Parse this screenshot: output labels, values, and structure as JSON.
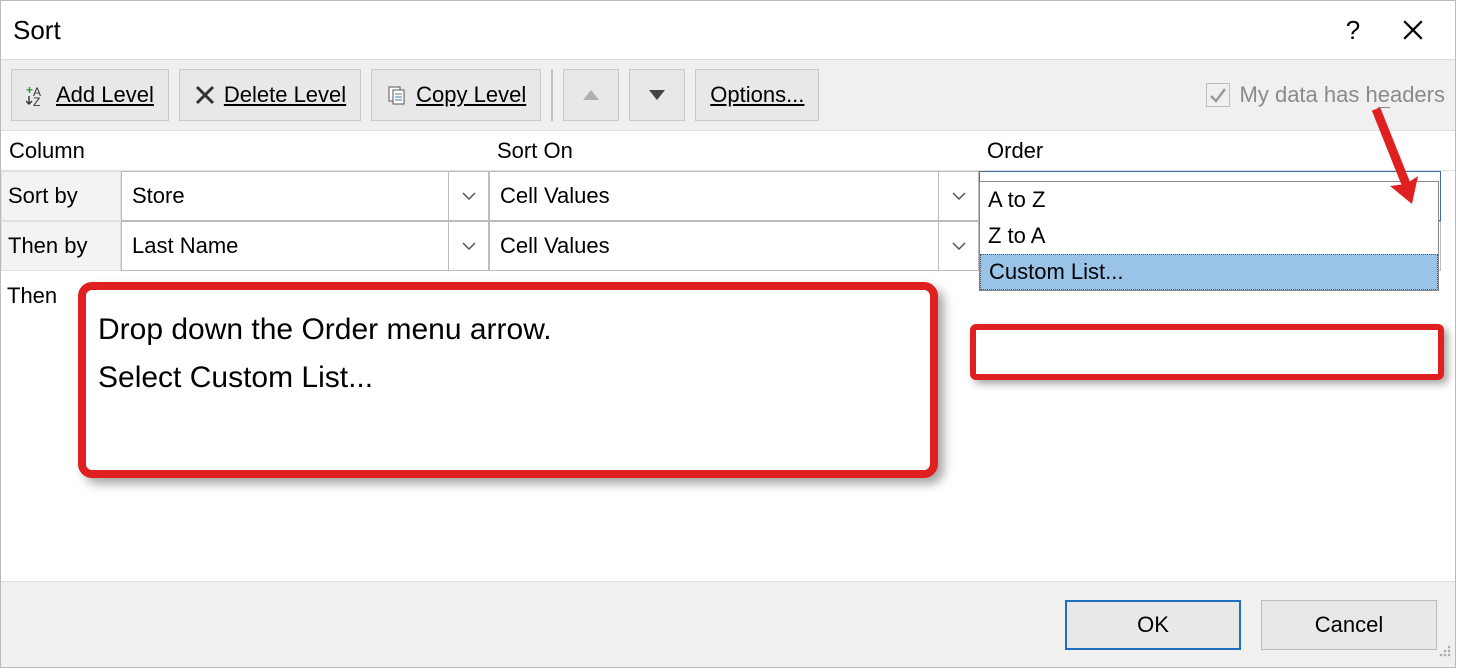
{
  "dialog": {
    "title": "Sort"
  },
  "toolbar": {
    "add_level": "Add Level",
    "delete_level": "Delete Level",
    "copy_level": "Copy Level",
    "options": "Options...",
    "headers_prefix": "My data has h",
    "headers_underlined": "e",
    "headers_suffix": "aders"
  },
  "headers": {
    "column": "Column",
    "sort_on": "Sort On",
    "order": "Order"
  },
  "rows": [
    {
      "label": "Sort by",
      "column": "Store",
      "sort_on": "Cell Values",
      "order": "A to Z"
    },
    {
      "label": "Then by",
      "column": "Last Name",
      "sort_on": "Cell Values",
      "order": ""
    },
    {
      "label": "Then",
      "column": "",
      "sort_on": "",
      "order": ""
    }
  ],
  "order_dropdown": {
    "options": [
      "A to Z",
      "Z to A",
      "Custom List..."
    ],
    "selected_index": 2
  },
  "callout": {
    "line1": "Drop down the Order menu arrow.",
    "line2": "Select Custom List..."
  },
  "footer": {
    "ok": "OK",
    "cancel": "Cancel"
  }
}
